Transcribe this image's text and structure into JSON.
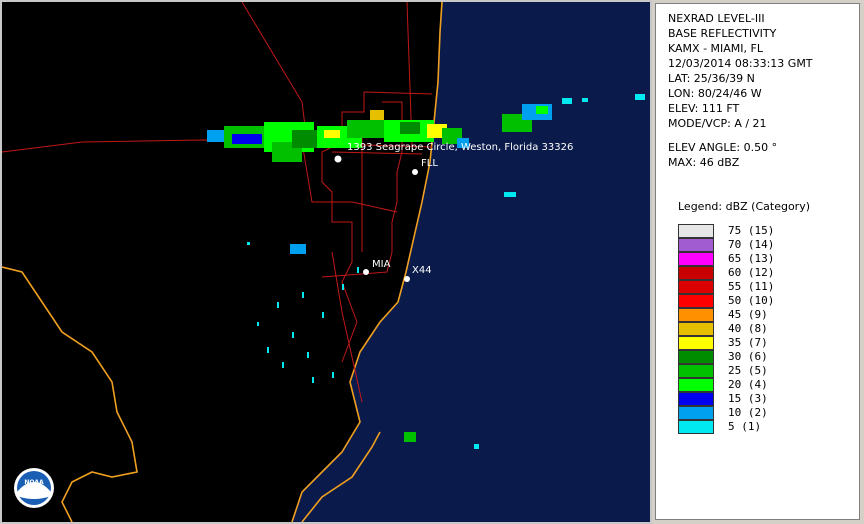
{
  "info": {
    "product": "NEXRAD LEVEL-III",
    "type": "BASE REFLECTIVITY",
    "station": "KAMX - MIAMI, FL",
    "datetime": "12/03/2014 08:33:13 GMT",
    "lat": "LAT: 25/36/39 N",
    "lon": "LON: 80/24/46 W",
    "elev": "ELEV: 111 FT",
    "mode": "MODE/VCP: A / 21",
    "elev_angle": "ELEV ANGLE: 0.50 °",
    "max": "MAX: 46 dBZ"
  },
  "legend": {
    "title": "Legend: dBZ (Category)",
    "items": [
      {
        "label": "75  (15)",
        "color": "#e6e6e6"
      },
      {
        "label": "70  (14)",
        "color": "#a05cd0"
      },
      {
        "label": "65  (13)",
        "color": "#ff00ff"
      },
      {
        "label": "60  (12)",
        "color": "#c80000"
      },
      {
        "label": "55  (11)",
        "color": "#dc0000"
      },
      {
        "label": "50  (10)",
        "color": "#ff0000"
      },
      {
        "label": "45  (9)",
        "color": "#ff9000"
      },
      {
        "label": "40  (8)",
        "color": "#e6c000"
      },
      {
        "label": "35  (7)",
        "color": "#ffff00"
      },
      {
        "label": "30  (6)",
        "color": "#008c00"
      },
      {
        "label": "25  (5)",
        "color": "#00c000"
      },
      {
        "label": "20  (4)",
        "color": "#00ff00"
      },
      {
        "label": "15  (3)",
        "color": "#0000f0"
      },
      {
        "label": "10  (2)",
        "color": "#00a0f0"
      },
      {
        "label": "5  (1)",
        "color": "#00e8f0"
      }
    ]
  },
  "map": {
    "water_color": "#0a1a4a",
    "land_color": "#000000",
    "coast_color": "#f0a020",
    "road_color": "#c01818",
    "address_label": "1393 Seagrape Circle, Weston, Florida 33326",
    "cities": [
      {
        "name": "FLL"
      },
      {
        "name": "MIA"
      },
      {
        "name": "X44"
      }
    ],
    "logo_text": "NOAA"
  }
}
